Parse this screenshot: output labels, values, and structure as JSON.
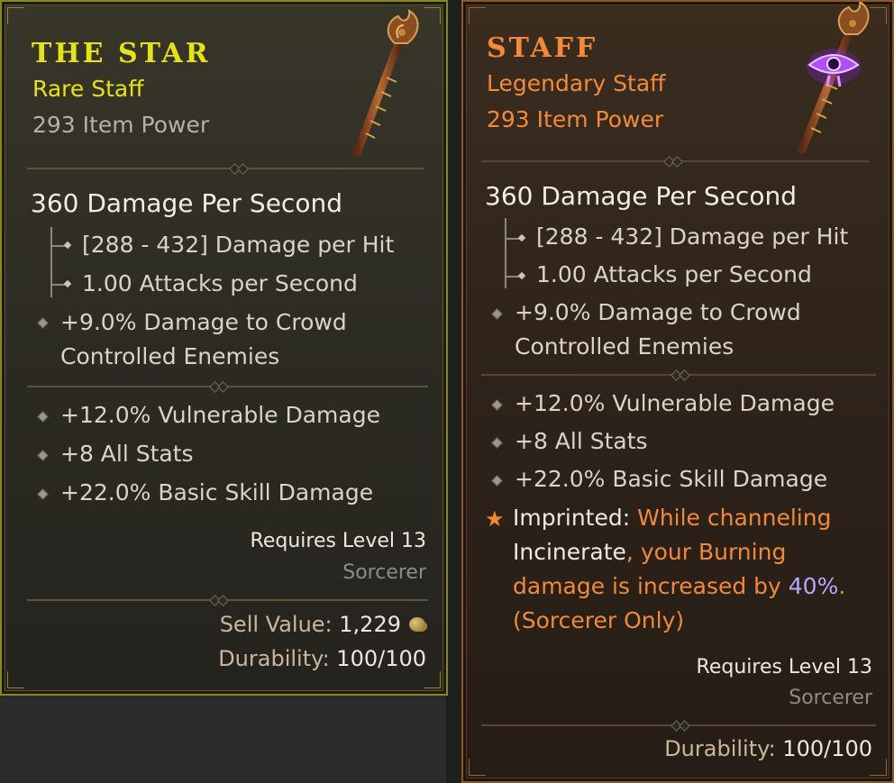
{
  "left_item": {
    "name": "THE STAR",
    "rarity_type": "Rare Staff",
    "item_power": "293 Item Power",
    "dps": "360 Damage Per Second",
    "damage_per_hit": "[288 - 432] Damage per Hit",
    "attacks_per_second": "1.00 Attacks per Second",
    "implicit_line1": "+9.0% Damage to Crowd",
    "implicit_line2": "Controlled Enemies",
    "affixes": [
      "+12.0% Vulnerable Damage",
      "+8 All Stats",
      "+22.0% Basic Skill Damage"
    ],
    "requires_level": "Requires Level 13",
    "class": "Sorcerer",
    "sell_label": "Sell Value: ",
    "sell_value": "1,229",
    "durability_label": "Durability: ",
    "durability_value": "100/100",
    "accent_color": "#e6e21a"
  },
  "right_item": {
    "name": "STAFF",
    "rarity_type": "Legendary Staff",
    "item_power": "293 Item Power",
    "dps": "360 Damage Per Second",
    "damage_per_hit": "[288 - 432] Damage per Hit",
    "attacks_per_second": "1.00 Attacks per Second",
    "implicit_line1": "+9.0% Damage to Crowd",
    "implicit_line2": "Controlled Enemies",
    "affixes": [
      "+12.0% Vulnerable Damage",
      "+8 All Stats",
      "+22.0% Basic Skill Damage"
    ],
    "aspect": {
      "label": "Imprinted: ",
      "part1": "While channeling",
      "skill": "Incinerate",
      "part2": ", your Burning",
      "part3": "damage is increased by ",
      "value": "40%",
      "part4": ".",
      "restriction": "(Sorcerer Only)"
    },
    "requires_level": "Requires Level 13",
    "class": "Sorcerer",
    "durability_label": "Durability: ",
    "durability_value": "100/100",
    "accent_color": "#f28a3a"
  },
  "icons": {
    "left_item_art": "staff-icon",
    "right_item_art": "staff-icon",
    "right_badge": "eye-imprint-icon",
    "gold": "gold-coin-icon",
    "aspect_marker": "star-icon"
  }
}
